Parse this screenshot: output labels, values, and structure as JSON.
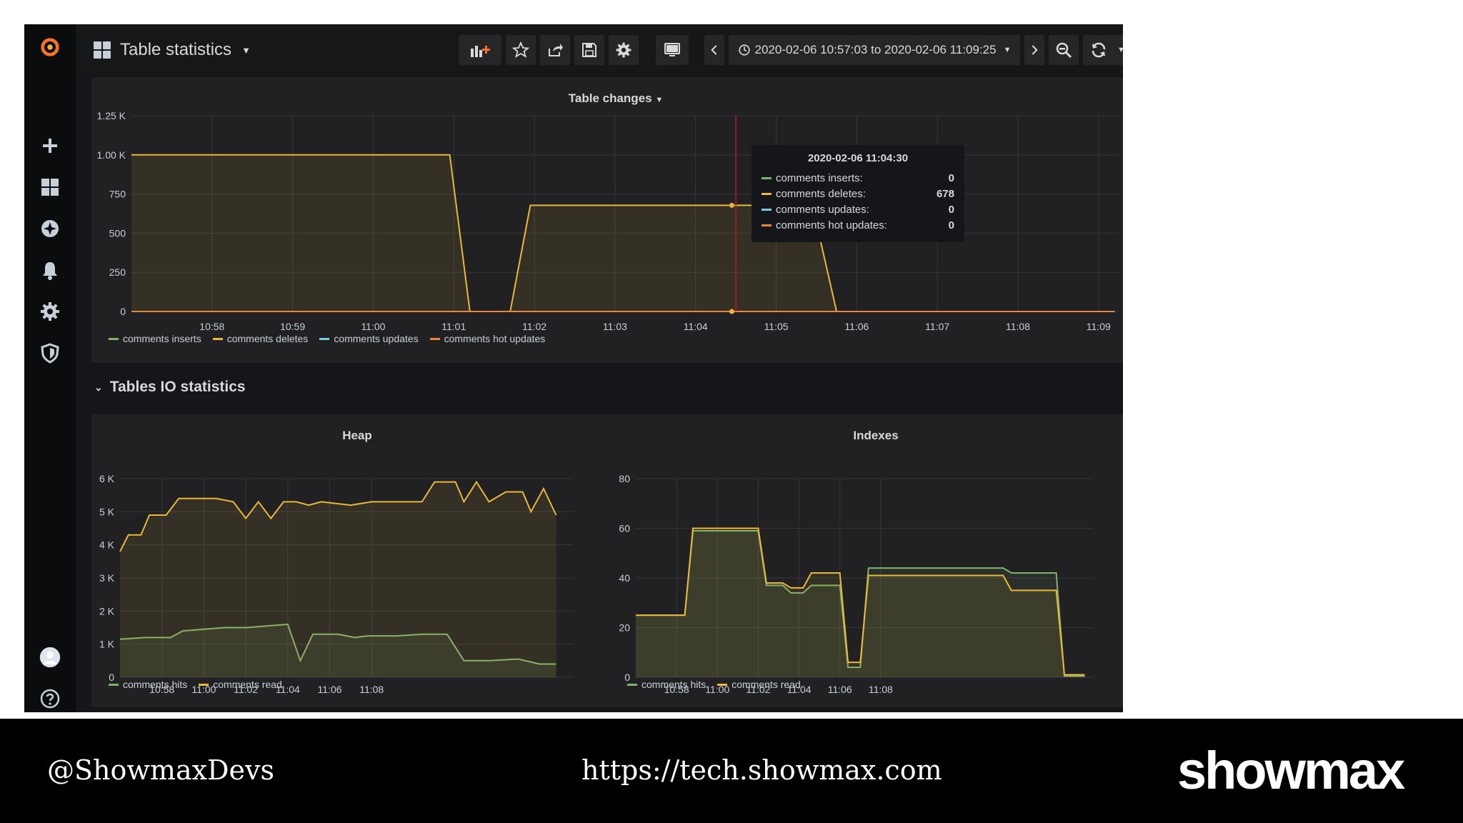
{
  "dashboard": {
    "title": "Table statistics"
  },
  "timepicker": {
    "range": "2020-02-06 10:57:03 to 2020-02-06 11:09:25"
  },
  "row": {
    "title": "Tables IO statistics"
  },
  "colors": {
    "inserts": "#7eb26d",
    "deletes": "#eab839",
    "updates": "#6ed0e0",
    "hot_updates": "#ef843c",
    "hits": "#7eb26d",
    "read": "#eab839",
    "marker": "#c4162a"
  },
  "tooltip": {
    "time": "2020-02-06 11:04:30",
    "rows": [
      {
        "label": "comments inserts:",
        "value": "0"
      },
      {
        "label": "comments deletes:",
        "value": "678"
      },
      {
        "label": "comments updates:",
        "value": "0"
      },
      {
        "label": "comments hot updates:",
        "value": "0"
      }
    ]
  },
  "footer": {
    "handle": "@ShowmaxDevs",
    "url": "https://tech.showmax.com",
    "logo": "showmax"
  },
  "icons": [
    "grafana-logo-icon",
    "plus-icon",
    "dashboards-icon",
    "explore-icon",
    "bell-icon",
    "gear-icon",
    "shield-icon",
    "user-avatar-icon",
    "help-icon"
  ],
  "chart_data": [
    {
      "type": "line",
      "title": "Table changes",
      "ylim": [
        0,
        1250
      ],
      "yticks": [
        "0",
        "250",
        "500",
        "750",
        "1.00 K",
        "1.25 K"
      ],
      "xticks": [
        "10:58",
        "10:59",
        "11:00",
        "11:01",
        "11:02",
        "11:03",
        "11:04",
        "11:05",
        "11:06",
        "11:07",
        "11:08",
        "11:09"
      ],
      "series": [
        {
          "name": "comments inserts",
          "points": [
            [
              0,
              0
            ],
            [
              12.2,
              0
            ]
          ]
        },
        {
          "name": "comments deletes",
          "points": [
            [
              0,
              1000
            ],
            [
              3.95,
              1000
            ],
            [
              4.2,
              0
            ],
            [
              4.7,
              0
            ],
            [
              4.95,
              678
            ],
            [
              8.45,
              678
            ],
            [
              8.75,
              0
            ],
            [
              12.2,
              0
            ]
          ]
        },
        {
          "name": "comments updates",
          "points": [
            [
              0,
              0
            ],
            [
              12.2,
              0
            ]
          ]
        },
        {
          "name": "comments hot updates",
          "points": [
            [
              0,
              0
            ],
            [
              12.2,
              0
            ]
          ]
        }
      ]
    },
    {
      "type": "line",
      "title": "Heap",
      "ylim": [
        0,
        6000
      ],
      "yticks": [
        "0",
        "1 K",
        "2 K",
        "3 K",
        "4 K",
        "5 K",
        "6 K"
      ],
      "xticks": [
        "10:58",
        "11:00",
        "11:02",
        "11:04",
        "11:06",
        "11:08"
      ],
      "series": [
        {
          "name": "comments hits",
          "points": [
            [
              0,
              1150
            ],
            [
              0.6,
              1200
            ],
            [
              1.2,
              1200
            ],
            [
              1.5,
              1400
            ],
            [
              2.0,
              1450
            ],
            [
              2.5,
              1500
            ],
            [
              3.0,
              1500
            ],
            [
              3.5,
              1550
            ],
            [
              4.0,
              1600
            ],
            [
              4.3,
              500
            ],
            [
              4.6,
              1300
            ],
            [
              5.2,
              1300
            ],
            [
              5.6,
              1200
            ],
            [
              5.9,
              1250
            ],
            [
              6.6,
              1250
            ],
            [
              7.2,
              1300
            ],
            [
              7.8,
              1300
            ],
            [
              8.2,
              500
            ],
            [
              8.8,
              500
            ],
            [
              9.5,
              550
            ],
            [
              10.0,
              400
            ],
            [
              10.4,
              400
            ]
          ]
        },
        {
          "name": "comments read",
          "points": [
            [
              0,
              3800
            ],
            [
              0.2,
              4300
            ],
            [
              0.5,
              4300
            ],
            [
              0.7,
              4900
            ],
            [
              1.1,
              4900
            ],
            [
              1.4,
              5400
            ],
            [
              1.8,
              5400
            ],
            [
              2.3,
              5400
            ],
            [
              2.7,
              5300
            ],
            [
              3.0,
              4800
            ],
            [
              3.3,
              5300
            ],
            [
              3.6,
              4800
            ],
            [
              3.9,
              5300
            ],
            [
              4.2,
              5300
            ],
            [
              4.5,
              5200
            ],
            [
              4.8,
              5300
            ],
            [
              5.5,
              5200
            ],
            [
              6.0,
              5300
            ],
            [
              7.2,
              5300
            ],
            [
              7.5,
              5900
            ],
            [
              8.0,
              5900
            ],
            [
              8.2,
              5300
            ],
            [
              8.5,
              5900
            ],
            [
              8.8,
              5300
            ],
            [
              9.2,
              5600
            ],
            [
              9.6,
              5600
            ],
            [
              9.8,
              5000
            ],
            [
              10.1,
              5700
            ],
            [
              10.4,
              4900
            ]
          ]
        }
      ]
    },
    {
      "type": "line",
      "title": "Indexes",
      "ylim": [
        0,
        80
      ],
      "yticks": [
        "0",
        "20",
        "40",
        "60",
        "80"
      ],
      "xticks": [
        "10:58",
        "11:00",
        "11:02",
        "11:04",
        "11:06",
        "11:08"
      ],
      "series": [
        {
          "name": "comments hits",
          "points": [
            [
              0,
              25
            ],
            [
              1.2,
              25
            ],
            [
              1.4,
              59
            ],
            [
              3.0,
              59
            ],
            [
              3.2,
              37
            ],
            [
              3.6,
              37
            ],
            [
              3.8,
              34
            ],
            [
              4.1,
              34
            ],
            [
              4.3,
              37
            ],
            [
              5.0,
              37
            ],
            [
              5.2,
              4
            ],
            [
              5.5,
              4
            ],
            [
              5.7,
              44
            ],
            [
              9.0,
              44
            ],
            [
              9.2,
              42
            ],
            [
              10.3,
              42
            ],
            [
              10.5,
              0.5
            ],
            [
              11.0,
              0.5
            ]
          ]
        },
        {
          "name": "comments read",
          "points": [
            [
              0,
              25
            ],
            [
              1.2,
              25
            ],
            [
              1.4,
              60
            ],
            [
              3.0,
              60
            ],
            [
              3.2,
              38
            ],
            [
              3.6,
              38
            ],
            [
              3.8,
              36
            ],
            [
              4.1,
              36
            ],
            [
              4.3,
              42
            ],
            [
              5.0,
              42
            ],
            [
              5.2,
              6
            ],
            [
              5.5,
              6
            ],
            [
              5.7,
              41
            ],
            [
              9.0,
              41
            ],
            [
              9.2,
              35
            ],
            [
              10.3,
              35
            ],
            [
              10.5,
              1
            ],
            [
              11.0,
              1
            ]
          ]
        }
      ]
    }
  ]
}
